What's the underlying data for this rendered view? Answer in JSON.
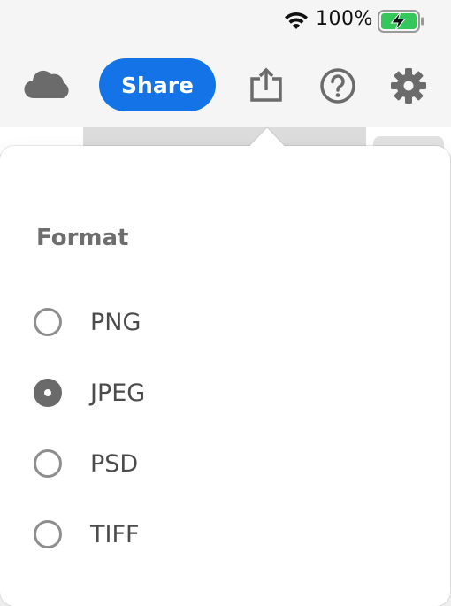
{
  "status_bar": {
    "battery_percent": "100%",
    "wifi_icon": "wifi-icon",
    "battery_icon": "battery-charging-icon",
    "battery_color": "#34c759"
  },
  "toolbar": {
    "cloud_icon": "cloud-icon",
    "share_label": "Share",
    "share_color": "#1473e6",
    "export_icon": "export-icon",
    "help_icon": "help-icon",
    "settings_icon": "gear-icon"
  },
  "popover": {
    "title": "Format",
    "options": [
      {
        "label": "PNG",
        "selected": false
      },
      {
        "label": "JPEG",
        "selected": true
      },
      {
        "label": "PSD",
        "selected": false
      },
      {
        "label": "TIFF",
        "selected": false
      }
    ]
  }
}
